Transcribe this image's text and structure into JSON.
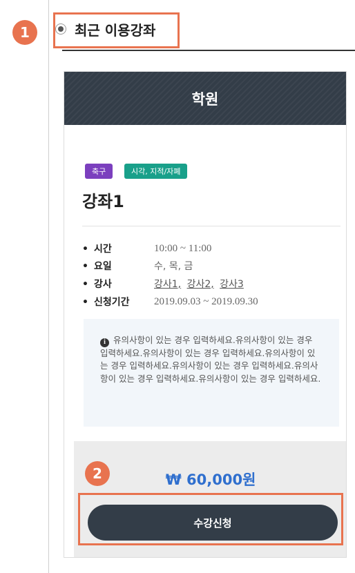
{
  "section": {
    "title": "최근 이용강좌"
  },
  "callouts": {
    "one": "1",
    "two": "2"
  },
  "card": {
    "header_title": "학원",
    "tags": [
      {
        "label": "축구",
        "color": "#7b3fbe"
      },
      {
        "label": "시각, 지적/자폐",
        "color": "#19a08a"
      }
    ],
    "course_title": "강좌1",
    "info": {
      "time_label": "시간",
      "time_value": "10:00 ~ 11:00",
      "day_label": "요일",
      "day_value": "수, 목, 금",
      "teacher_label": "강사",
      "teachers": [
        "강사1,",
        "강사2,",
        "강사3"
      ],
      "period_label": "신청기간",
      "period_value": "2019.09.03 ~ 2019.09.30"
    },
    "notice": {
      "icon": "i",
      "text": "유의사항이 있는 경우 입력하세요.유의사항이 있는 경우 입력하세요.유의사항이 있는 경우 입력하세요.유의사항이 있는 경우 입력하세요.유의사항이 있는 경우 입력하세요.유의사항이 있는 경우 입력하세요.유의사항이 있는 경우 입력하세요."
    },
    "price": "₩ 60,000원",
    "apply_label": "수강신청"
  },
  "colors": {
    "accent": "#e8734f",
    "header_bg": "#333d48",
    "price": "#2f6fce"
  }
}
